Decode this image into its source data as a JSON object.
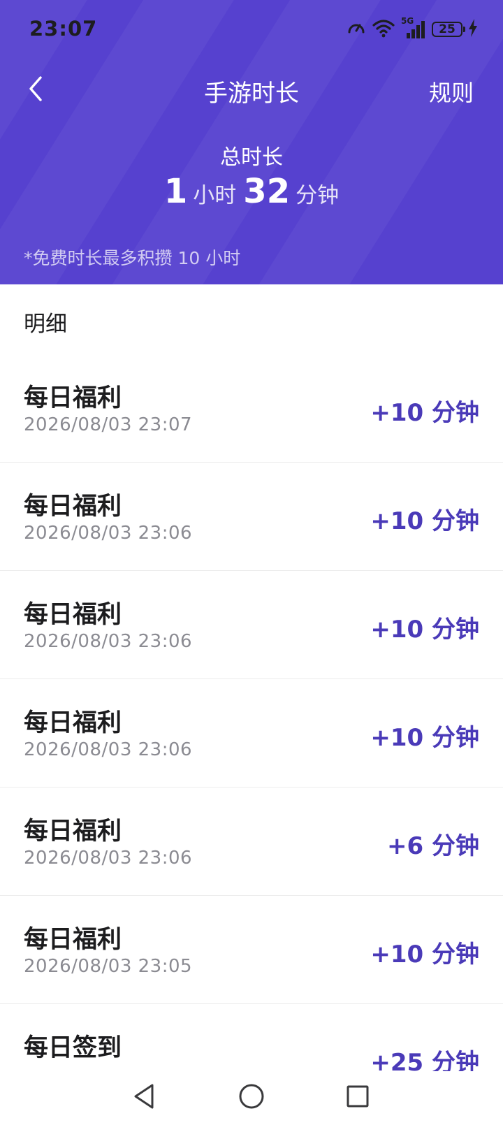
{
  "status_bar": {
    "time": "23:07",
    "battery": "25",
    "network": "5G",
    "icons": [
      "speed-icon",
      "wifi-icon",
      "cellular-signal-icon",
      "battery-icon",
      "charging-icon"
    ]
  },
  "nav": {
    "title": "手游时长",
    "rules_label": "规则",
    "back_icon": "chevron-left-icon"
  },
  "summary": {
    "label": "总时长",
    "hours": "1",
    "hours_unit": "小时",
    "minutes": "32",
    "minutes_unit": "分钟",
    "note": "*免费时长最多积攒 10 小时"
  },
  "details": {
    "title": "明细",
    "items": [
      {
        "title": "每日福利",
        "time": "2026/08/03 23:07",
        "amount": "+10 分钟"
      },
      {
        "title": "每日福利",
        "time": "2026/08/03 23:06",
        "amount": "+10 分钟"
      },
      {
        "title": "每日福利",
        "time": "2026/08/03 23:06",
        "amount": "+10 分钟"
      },
      {
        "title": "每日福利",
        "time": "2026/08/03 23:06",
        "amount": "+10 分钟"
      },
      {
        "title": "每日福利",
        "time": "2026/08/03 23:06",
        "amount": "+6 分钟"
      },
      {
        "title": "每日福利",
        "time": "2026/08/03 23:05",
        "amount": "+10 分钟"
      },
      {
        "title": "每日签到",
        "time": "",
        "amount": "+25 分钟"
      }
    ]
  },
  "system_nav": {
    "icons": [
      "back-triangle-icon",
      "home-circle-icon",
      "recents-square-icon"
    ]
  },
  "colors": {
    "header_bg": "#5641cf",
    "accent": "#4a3ab8",
    "text_primary": "#1c1c1e",
    "text_secondary": "#8b8b92"
  }
}
